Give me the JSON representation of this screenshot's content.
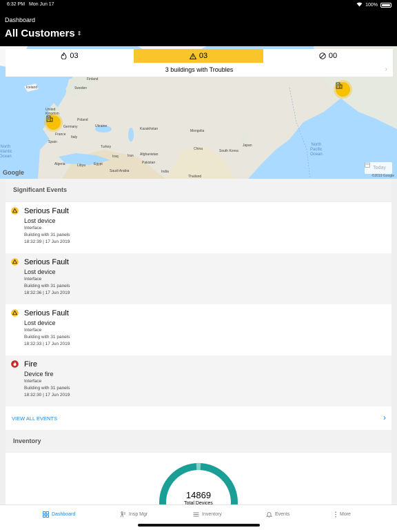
{
  "status_bar": {
    "time": "6:32 PM",
    "date": "Mon Jun 17",
    "battery": "100%"
  },
  "header": {
    "breadcrumb": "Dashboard",
    "title": "All Customers"
  },
  "counts": {
    "fire": "03",
    "trouble": "03",
    "disabled": "00",
    "summary": "3 buildings with Troubles"
  },
  "map": {
    "labels": {
      "finland": "Finland",
      "sweden": "Sweden",
      "iceland": "Iceland",
      "uk": "United Kingdom",
      "germany": "Germany",
      "poland": "Poland",
      "ukraine": "Ukraine",
      "france": "France",
      "spain": "Spain",
      "italy": "Italy",
      "turkey": "Turkey",
      "iraq": "Iraq",
      "iran": "Iran",
      "algeria": "Algeria",
      "libya": "Libya",
      "egypt": "Egypt",
      "saudi": "Saudi Arabia",
      "kazakhstan": "Kazakhstan",
      "mongolia": "Mongolia",
      "china": "China",
      "afghanistan": "Afghanistan",
      "pakistan": "Pakistan",
      "india": "India",
      "thailand": "Thailand",
      "japan": "Japan",
      "southkorea": "South Korea",
      "north_atlantic": "North\nAtlantic\nOcean",
      "north_pacific": "North\nPacific\nOcean"
    },
    "google": "Google",
    "today": "Today",
    "copyright": "©2019 Google"
  },
  "significant_events": {
    "heading": "Significant Events",
    "items": [
      {
        "type": "trouble",
        "title": "Serious Fault",
        "sub": "Lost device",
        "device": "Interface",
        "building": "Building with 31 panels",
        "time": "18:32:39  |  17 Jun 2019"
      },
      {
        "type": "trouble",
        "title": "Serious Fault",
        "sub": "Lost device",
        "device": "Interface",
        "building": "Building with 31 panels",
        "time": "18:32:36  |  17 Jun 2019"
      },
      {
        "type": "trouble",
        "title": "Serious Fault",
        "sub": "Lost device",
        "device": "Interface",
        "building": "Building with 31 panels",
        "time": "18:32:33  |  17 Jun 2019"
      },
      {
        "type": "fire",
        "title": "Fire",
        "sub": "Device fire",
        "device": "Interface",
        "building": "Building with 31 panels",
        "time": "18:32:30  |  17 Jun 2019"
      }
    ],
    "view_all": "VIEW ALL EVENTS"
  },
  "inventory": {
    "heading": "Inventory",
    "total": "14869",
    "total_label": "Total Devices"
  },
  "tabs": {
    "dashboard": "Dashboard",
    "insp_mgr": "Insp Mgr",
    "inventory": "Inventory",
    "events": "Events",
    "more": "More"
  },
  "colors": {
    "accent": "#1e88d9",
    "trouble": "#f9c52b",
    "fire": "#c62828",
    "donut": "#1a9e96"
  }
}
